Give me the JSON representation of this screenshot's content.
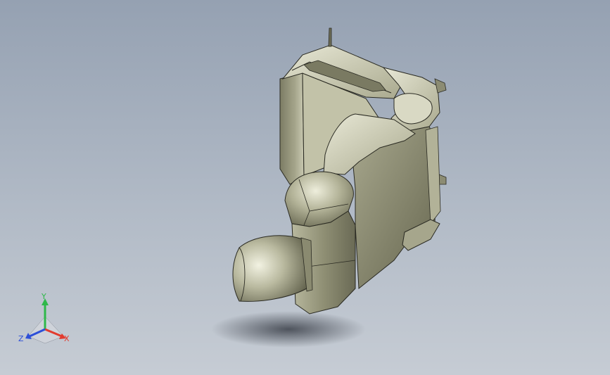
{
  "triad": {
    "x_label": "X",
    "y_label": "Y",
    "z_label": "Z",
    "x_color": "#e23b2e",
    "y_color": "#2fb84a",
    "z_color": "#2d4fd8"
  },
  "colors": {
    "body": "#9a9a7f",
    "body_light": "#d6d6c0",
    "body_dark": "#5c5c48",
    "edge": "#2a2a22"
  }
}
